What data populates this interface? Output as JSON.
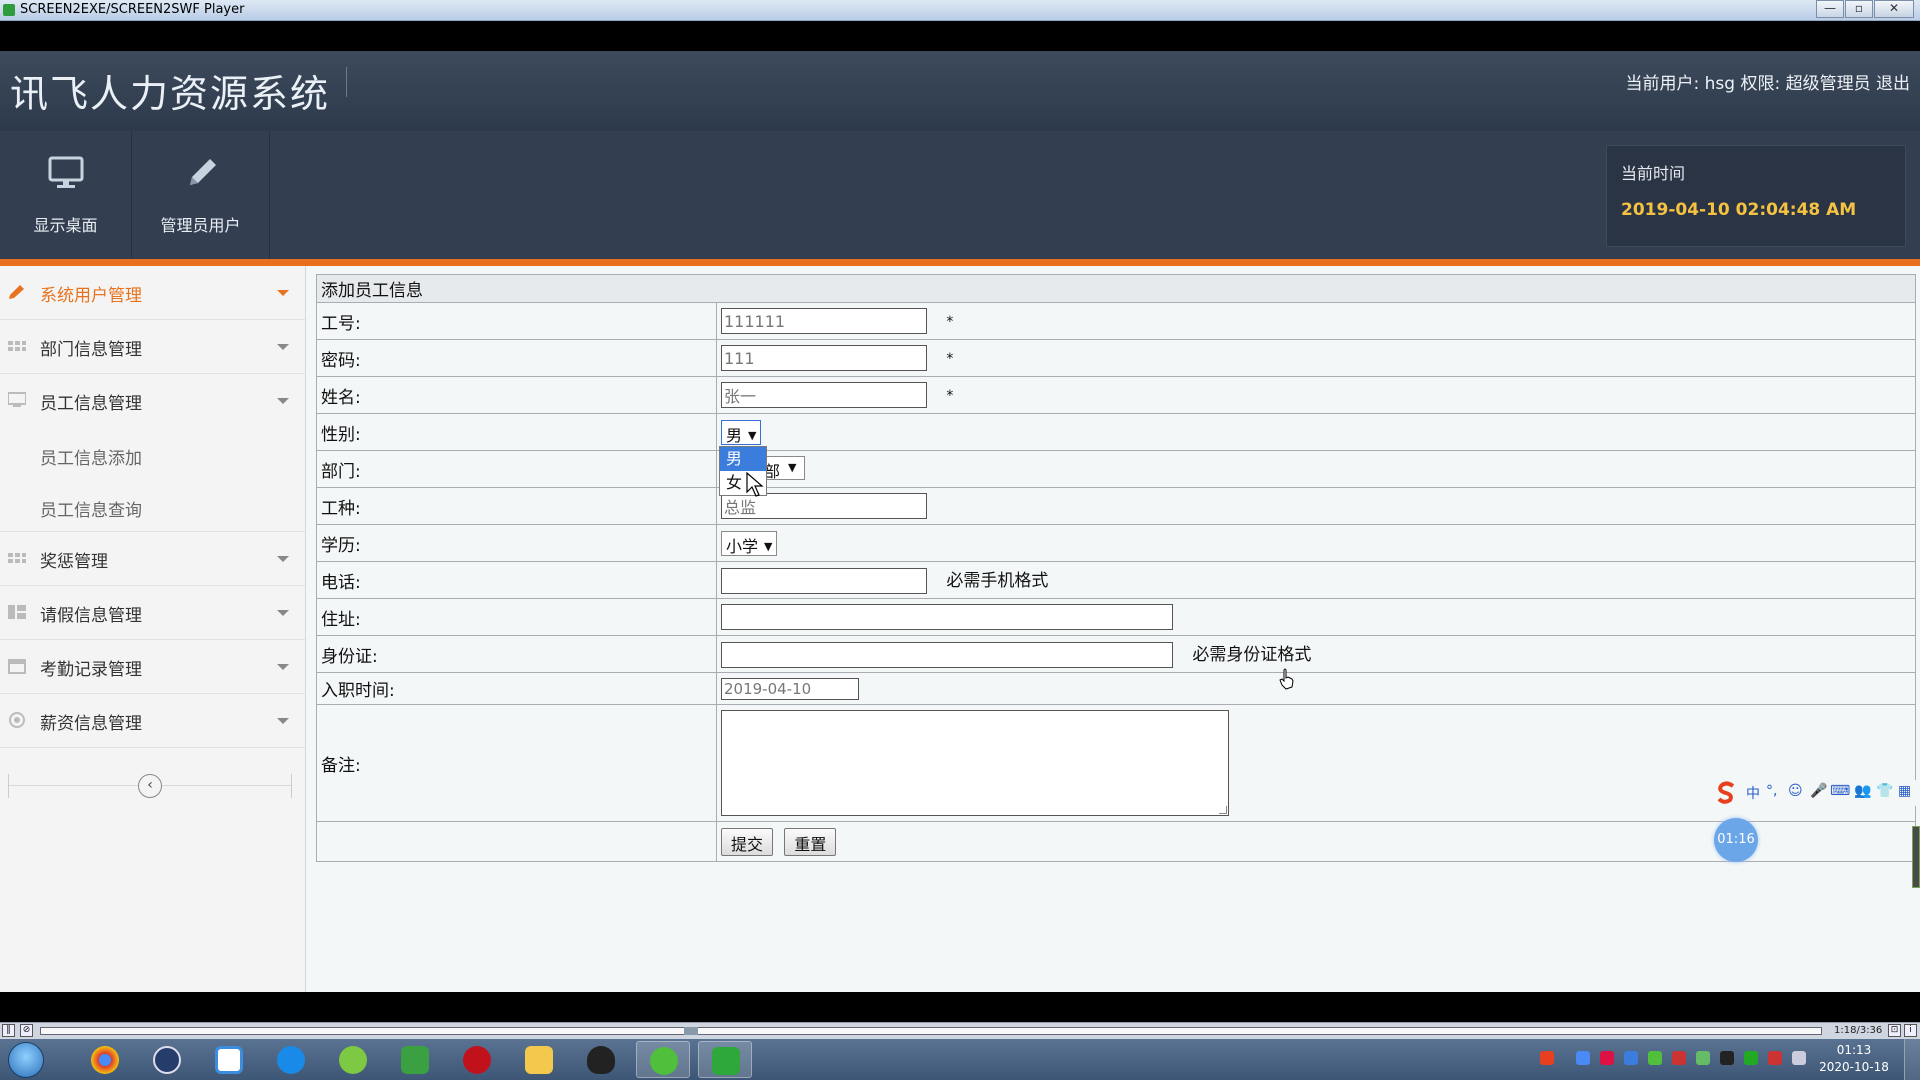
{
  "player": {
    "title": "SCREEN2EXE/SCREEN2SWF Player",
    "minimize": "—",
    "restore": "▫",
    "close": "✕",
    "time": "1:18/3:36"
  },
  "app": {
    "title": "讯飞人力资源系统",
    "user_info": "当前用户: hsg 权限: 超级管理员 退出",
    "toolbar": {
      "desktop_label": "显示桌面",
      "admin_label": "管理员用户"
    },
    "time_box": {
      "label": "当前时间",
      "value": "2019-04-10 02:04:48 AM"
    }
  },
  "sidebar": {
    "items": [
      {
        "label": "系统用户管理",
        "icon": "pencil-icon"
      },
      {
        "label": "部门信息管理",
        "icon": "grid-icon"
      },
      {
        "label": "员工信息管理",
        "icon": "monitor-icon"
      },
      {
        "label": "奖惩管理",
        "icon": "grid-icon"
      },
      {
        "label": "请假信息管理",
        "icon": "list-icon"
      },
      {
        "label": "考勤记录管理",
        "icon": "calendar-icon"
      },
      {
        "label": "薪资信息管理",
        "icon": "globe-icon"
      }
    ],
    "sub_items": [
      "员工信息添加",
      "员工信息查询"
    ],
    "collapse": "‹"
  },
  "form": {
    "header": "添加员工信息",
    "fields": {
      "emp_no": {
        "label": "工号:",
        "value": "111111"
      },
      "password": {
        "label": "密码:",
        "value": "111"
      },
      "name": {
        "label": "姓名:",
        "value": "张一"
      },
      "gender": {
        "label": "性别:",
        "value": "男",
        "options": [
          "男",
          "女"
        ]
      },
      "dept": {
        "label": "部门:",
        "value": "部"
      },
      "job": {
        "label": "工种:",
        "value": "总监"
      },
      "edu": {
        "label": "学历:",
        "value": "小学"
      },
      "phone": {
        "label": "电话:",
        "value": "",
        "hint": "必需手机格式"
      },
      "address": {
        "label": "住址:",
        "value": ""
      },
      "id_card": {
        "label": "身份证:",
        "value": "",
        "hint": "必需身份证格式"
      },
      "hire_date": {
        "label": "入职时间:",
        "value": "2019-04-10"
      },
      "remark": {
        "label": "备注:"
      }
    },
    "required_mark": "*",
    "submit": "提交",
    "reset": "重置"
  },
  "overlay": {
    "timer": "01:16",
    "ime": [
      "中",
      "°,",
      "☺",
      "🎤",
      "⌨",
      "👥",
      "👕",
      "▦"
    ]
  },
  "taskbar": {
    "clock_time": "01:13",
    "clock_date": "2020-10-18"
  },
  "colors": {
    "accent": "#e86f1d",
    "header_bg": "#333f51",
    "time_value": "#f5c242",
    "highlight": "#3b7ddc"
  }
}
